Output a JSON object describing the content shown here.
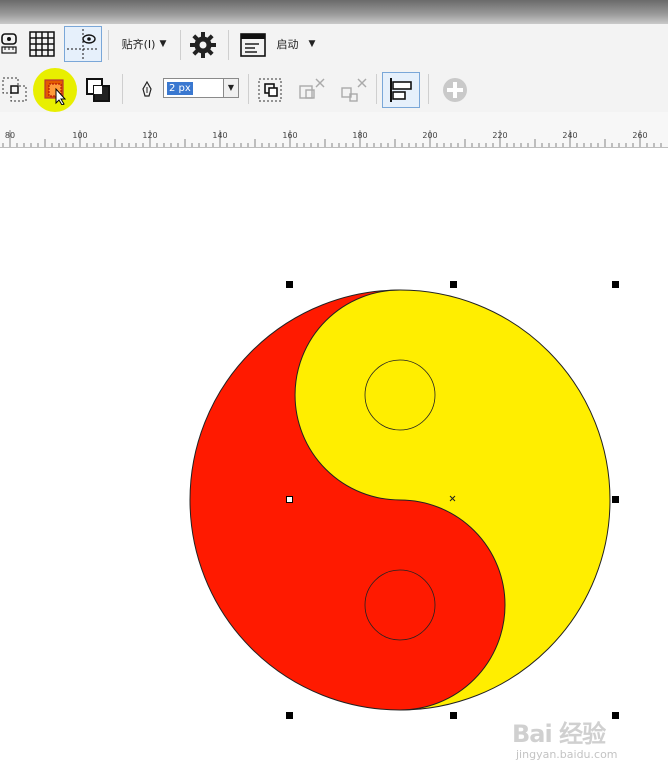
{
  "toolbar1": {
    "snap_label": "贴齐(I)",
    "launch_label": "启动"
  },
  "toolbar2": {
    "outline_width": "2 px"
  },
  "ruler": {
    "ticks": [
      "80",
      "100",
      "120",
      "140",
      "160",
      "180",
      "200",
      "220",
      "240",
      "260"
    ]
  },
  "colors": {
    "yin": "#ff1a00",
    "yang": "#ffee00",
    "highlight": "#e8ef00"
  },
  "watermark": {
    "brand": "Bai 经验",
    "sub": "jingyan.baidu.com"
  }
}
